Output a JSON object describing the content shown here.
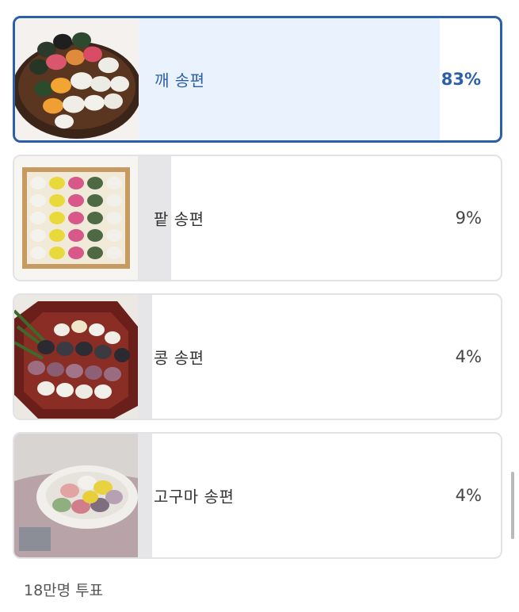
{
  "poll": {
    "options": [
      {
        "label": "깨 송편",
        "percent": "83%",
        "share": 0.83,
        "selected": true,
        "image": "sesame-songpyeon-photo"
      },
      {
        "label": "팥 송편",
        "percent": "9%",
        "share": 0.09,
        "selected": false,
        "image": "redbean-songpyeon-photo"
      },
      {
        "label": "콩 송편",
        "percent": "4%",
        "share": 0.04,
        "selected": false,
        "image": "bean-songpyeon-photo"
      },
      {
        "label": "고구마 송편",
        "percent": "4%",
        "share": 0.04,
        "selected": false,
        "image": "sweetpotato-songpyeon-photo"
      }
    ],
    "vote_count": "18만명 투표"
  },
  "colors": {
    "accent": "#2b5fa8",
    "selected_bar": "#eaf3fd",
    "bar": "#e6e6e8"
  }
}
